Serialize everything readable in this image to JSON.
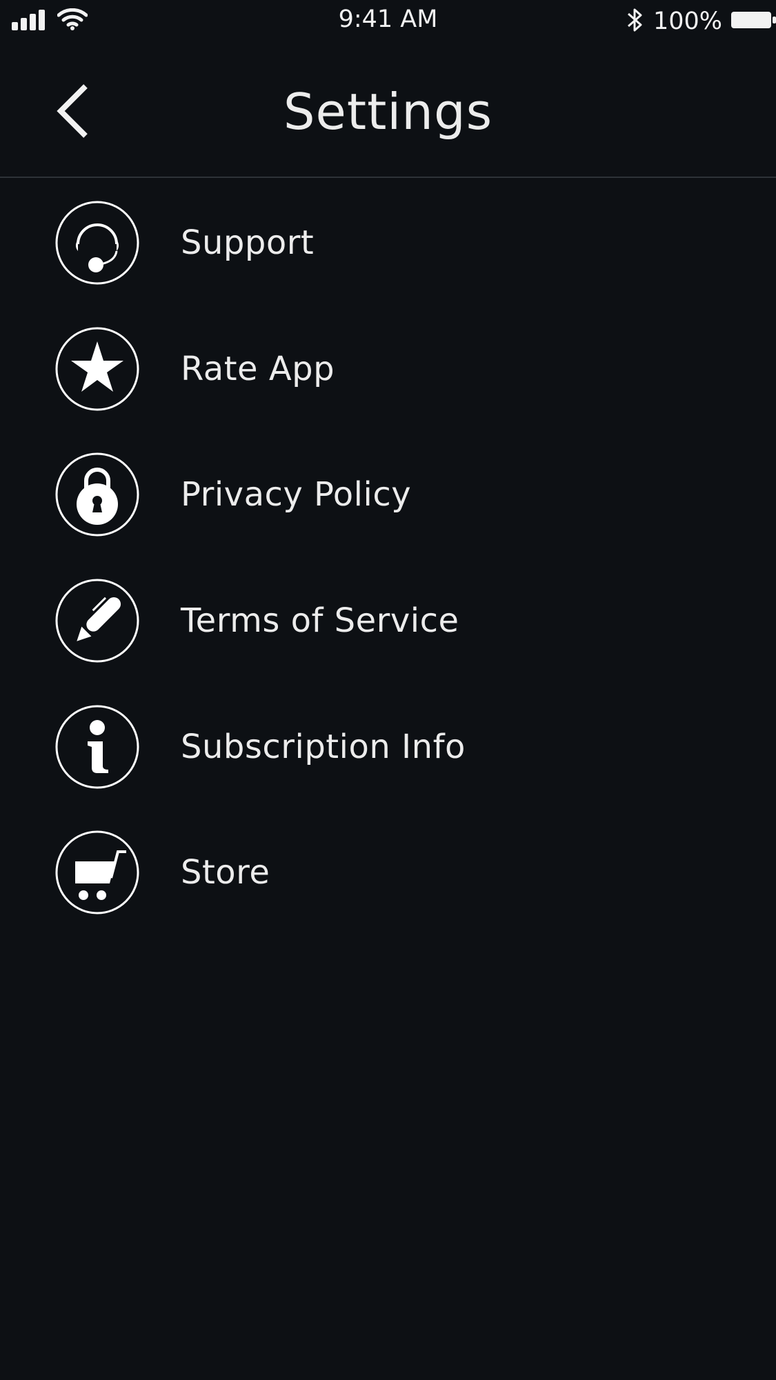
{
  "status_bar": {
    "time": "9:41 AM",
    "battery_percent": "100%",
    "signal_icon": "cellular-signal-icon",
    "wifi_icon": "wifi-icon",
    "bluetooth_icon": "bluetooth-icon",
    "battery_icon": "battery-icon"
  },
  "nav": {
    "title": "Settings",
    "back_icon": "chevron-left-icon"
  },
  "settings": {
    "items": [
      {
        "label": "Support",
        "icon": "headset-icon"
      },
      {
        "label": "Rate App",
        "icon": "star-icon"
      },
      {
        "label": "Privacy Policy",
        "icon": "lock-icon"
      },
      {
        "label": "Terms of Service",
        "icon": "pencil-icon"
      },
      {
        "label": "Subscription Info",
        "icon": "info-icon"
      },
      {
        "label": "Store",
        "icon": "cart-icon"
      }
    ]
  },
  "colors": {
    "background": "#0d1014",
    "text": "#ececec",
    "divider": "#2e3338"
  }
}
